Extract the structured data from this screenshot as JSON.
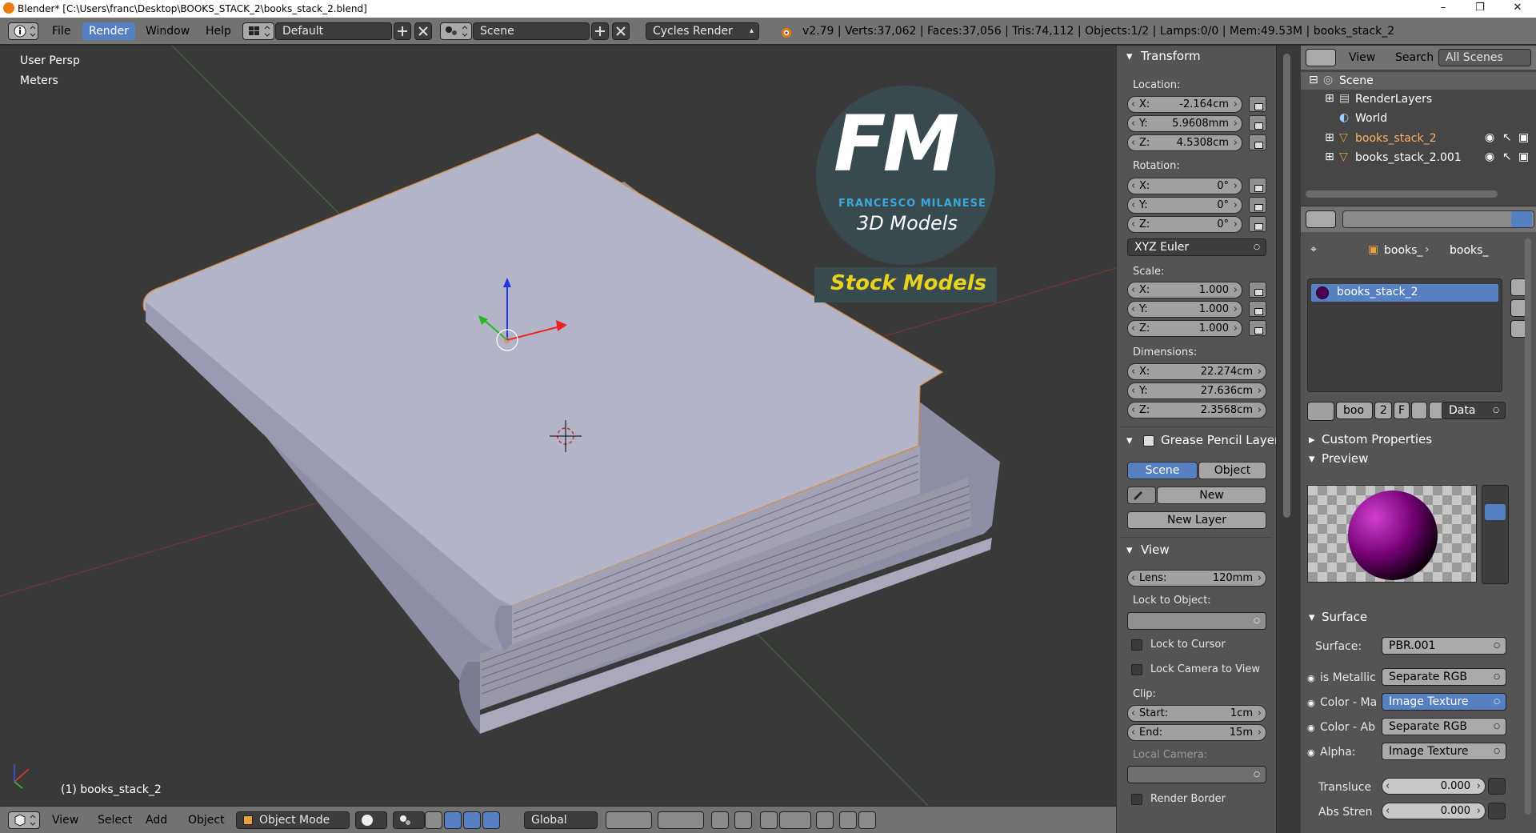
{
  "window": {
    "title": "Blender* [C:\\Users\\franc\\Desktop\\BOOKS_STACK_2\\books_stack_2.blend]",
    "min_glyph": "–",
    "max_glyph": "❐",
    "close_glyph": "✕"
  },
  "menus": {
    "file": "File",
    "render": "Render",
    "window": "Window",
    "help": "Help"
  },
  "layout": {
    "name": "Default"
  },
  "scene": {
    "name": "Scene"
  },
  "engine": {
    "name": "Cycles Render"
  },
  "stats": "v2.79 | Verts:37,062 | Faces:37,056 | Tris:74,112 | Objects:1/2 | Lamps:0/0 | Mem:49.53M | books_stack_2",
  "viewport": {
    "view_name": "User Persp",
    "units": "Meters",
    "object_label": "(1) books_stack_2",
    "watermark": {
      "initials": "FM",
      "brand": "FRANCESCO MILANESE",
      "subtitle": "3D Models",
      "tag": "Stock Models"
    }
  },
  "vp_header": {
    "view": "View",
    "select": "Select",
    "add": "Add",
    "object": "Object",
    "mode": "Object Mode",
    "orientation": "Global"
  },
  "npanel": {
    "transform_title": "Transform",
    "location_label": "Location:",
    "location": [
      {
        "k": "X:",
        "v": "-2.164cm"
      },
      {
        "k": "Y:",
        "v": "5.9608mm"
      },
      {
        "k": "Z:",
        "v": "4.5308cm"
      }
    ],
    "rotation_label": "Rotation:",
    "rotation": [
      {
        "k": "X:",
        "v": "0°"
      },
      {
        "k": "Y:",
        "v": "0°"
      },
      {
        "k": "Z:",
        "v": "0°"
      }
    ],
    "rotation_mode": "XYZ Euler",
    "scale_label": "Scale:",
    "scale": [
      {
        "k": "X:",
        "v": "1.000"
      },
      {
        "k": "Y:",
        "v": "1.000"
      },
      {
        "k": "Z:",
        "v": "1.000"
      }
    ],
    "dimensions_label": "Dimensions:",
    "dimensions": [
      {
        "k": "X:",
        "v": "22.274cm"
      },
      {
        "k": "Y:",
        "v": "27.636cm"
      },
      {
        "k": "Z:",
        "v": "2.3568cm"
      }
    ],
    "grease_title": "Grease Pencil Layer",
    "grease_scene": "Scene",
    "grease_object": "Object",
    "grease_new": "New",
    "grease_new_layer": "New Layer",
    "view_title": "View",
    "lens_label": "Lens:",
    "lens_value": "120mm",
    "lock_object_label": "Lock to Object:",
    "lock_cursor": "Lock to Cursor",
    "lock_camera": "Lock Camera to View",
    "clip_label": "Clip:",
    "clip_start_label": "Start:",
    "clip_start": "1cm",
    "clip_end_label": "End:",
    "clip_end": "15m",
    "local_camera": "Local Camera:",
    "render_border": "Render Border"
  },
  "outliner": {
    "view": "View",
    "search": "Search",
    "filter": "All Scenes",
    "items": [
      {
        "label": "Scene"
      },
      {
        "label": "RenderLayers"
      },
      {
        "label": "World"
      },
      {
        "label": "books_stack_2"
      },
      {
        "label": "books_stack_2.001"
      }
    ]
  },
  "properties": {
    "breadcrumb_1": "books_",
    "breadcrumb_2": "books_",
    "material_slot": "books_stack_2",
    "mat_short": "boo",
    "mat_users": "2",
    "mat_fake": "F",
    "link": "Data",
    "custom_props": "Custom Properties",
    "preview": "Preview",
    "surface_title": "Surface",
    "surface_label": "Surface:",
    "surface_value": "PBR.001",
    "inputs": [
      {
        "label": "is Metallic",
        "value": "Separate RGB"
      },
      {
        "label": "Color - Ma",
        "value": "Image Texture"
      },
      {
        "label": "Color - Ab",
        "value": "Separate RGB"
      },
      {
        "label": "Alpha:",
        "value": "Image Texture"
      }
    ],
    "translucency_label": "Transluce",
    "translucency": "0.000",
    "abs_label": "Abs Stren",
    "abs": "0.000"
  }
}
